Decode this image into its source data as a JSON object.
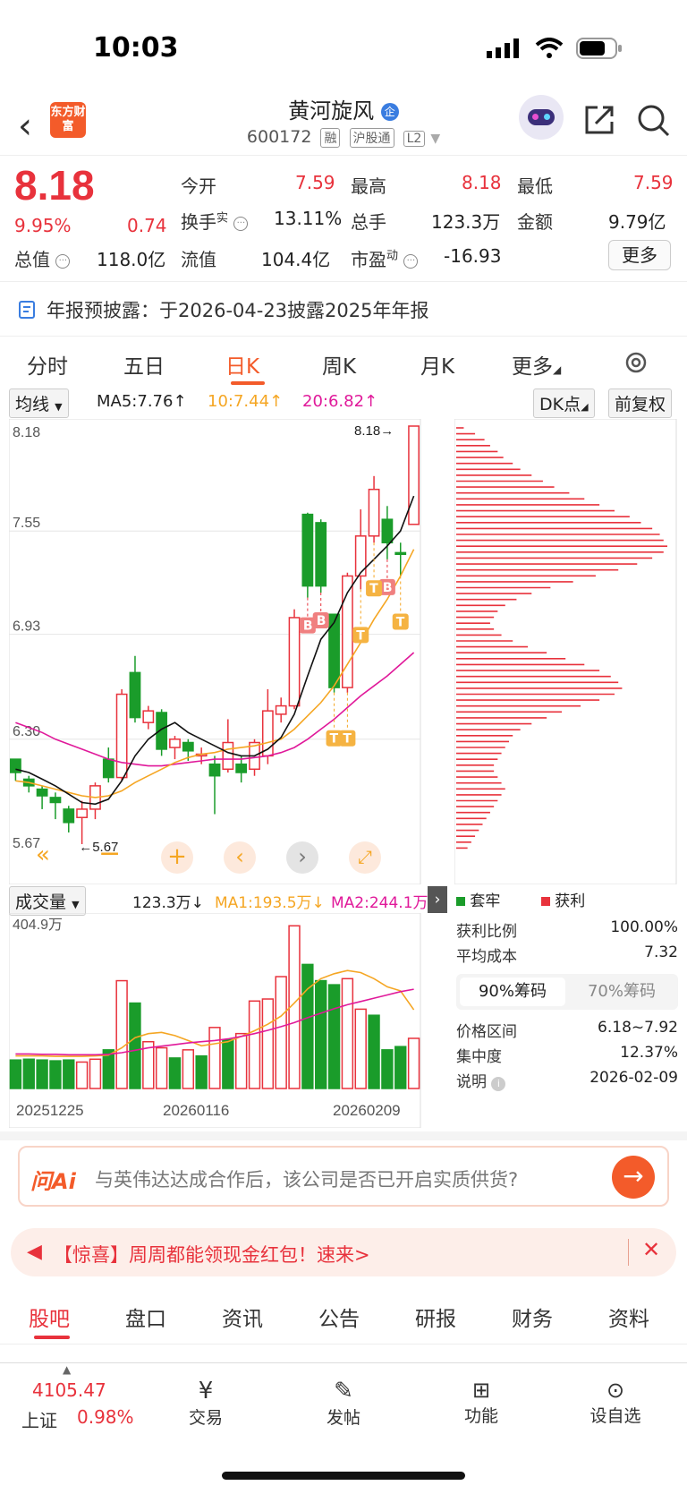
{
  "status": {
    "time": "10:03"
  },
  "header": {
    "logo_text": "东方财富",
    "title": "黄河旋风",
    "title_badge": "企",
    "code": "600172",
    "tags": [
      "融",
      "沪股通",
      "L2"
    ]
  },
  "quote": {
    "price": "8.18",
    "change_pct": "9.95%",
    "change": "0.74",
    "open_label": "今开",
    "open": "7.59",
    "high_label": "最高",
    "high": "8.18",
    "low_label": "最低",
    "low": "7.59",
    "turnover_label": "换手",
    "turnover_sup": "实",
    "turnover": "13.11%",
    "volume_label": "总手",
    "volume": "123.3万",
    "amount_label": "金额",
    "amount": "9.79亿",
    "mktcap_label": "总值",
    "mktcap": "118.0亿",
    "float_label": "流值",
    "float": "104.4亿",
    "pe_label": "市盈",
    "pe_sup": "动",
    "pe": "-16.93",
    "more_label": "更多"
  },
  "notice": {
    "text": "年报预披露：于2026-04-23披露2025年年报"
  },
  "ktabs": [
    "分时",
    "五日",
    "日K",
    "周K",
    "月K",
    "更多"
  ],
  "ma_bar": {
    "select": "均线",
    "ma5": "MA5:7.76↑",
    "ma10": "10:7.44↑",
    "ma20": "20:6.82↑",
    "dk": "DK点",
    "adjust": "前复权",
    "colors": {
      "ma5": "#111111",
      "ma10": "#f5a623",
      "ma20": "#e0199a"
    }
  },
  "chart_data": [
    {
      "type": "candlestick",
      "y_tick_labels": [
        "8.18",
        "7.55",
        "6.93",
        "6.30",
        "5.67"
      ],
      "ylim": [
        5.67,
        8.18
      ],
      "annotations": [
        "8.18→",
        "←5.67"
      ],
      "candles": [
        {
          "o": 6.18,
          "c": 6.1,
          "h": 6.18,
          "l": 6.05
        },
        {
          "o": 6.06,
          "c": 6.02,
          "h": 6.08,
          "l": 5.98
        },
        {
          "o": 6.0,
          "c": 5.96,
          "h": 6.02,
          "l": 5.88
        },
        {
          "o": 5.95,
          "c": 5.92,
          "h": 5.98,
          "l": 5.82
        },
        {
          "o": 5.88,
          "c": 5.8,
          "h": 5.9,
          "l": 5.74
        },
        {
          "o": 5.83,
          "c": 5.88,
          "h": 5.93,
          "l": 5.67
        },
        {
          "o": 5.88,
          "c": 6.02,
          "h": 6.04,
          "l": 5.82
        },
        {
          "o": 6.18,
          "c": 6.07,
          "h": 6.25,
          "l": 6.04
        },
        {
          "o": 6.07,
          "c": 6.57,
          "h": 6.6,
          "l": 6.05
        },
        {
          "o": 6.7,
          "c": 6.43,
          "h": 6.8,
          "l": 6.4
        },
        {
          "o": 6.4,
          "c": 6.47,
          "h": 6.5,
          "l": 6.36
        },
        {
          "o": 6.46,
          "c": 6.24,
          "h": 6.48,
          "l": 6.2
        },
        {
          "o": 6.25,
          "c": 6.3,
          "h": 6.32,
          "l": 6.18
        },
        {
          "o": 6.28,
          "c": 6.23,
          "h": 6.3,
          "l": 6.17
        },
        {
          "o": 6.2,
          "c": 6.21,
          "h": 6.25,
          "l": 6.15
        },
        {
          "o": 6.15,
          "c": 6.08,
          "h": 6.2,
          "l": 5.85
        },
        {
          "o": 6.12,
          "c": 6.28,
          "h": 6.42,
          "l": 6.1
        },
        {
          "o": 6.15,
          "c": 6.1,
          "h": 6.2,
          "l": 6.04
        },
        {
          "o": 6.12,
          "c": 6.28,
          "h": 6.3,
          "l": 6.08
        },
        {
          "o": 6.2,
          "c": 6.47,
          "h": 6.6,
          "l": 6.15
        },
        {
          "o": 6.45,
          "c": 6.5,
          "h": 6.55,
          "l": 6.4
        },
        {
          "o": 6.5,
          "c": 7.03,
          "h": 7.08,
          "l": 6.48
        },
        {
          "o": 7.65,
          "c": 7.22,
          "h": 7.66,
          "l": 7.15
        },
        {
          "o": 7.6,
          "c": 7.22,
          "h": 7.62,
          "l": 7.18
        },
        {
          "o": 7.05,
          "c": 6.61,
          "h": 7.05,
          "l": 6.58
        },
        {
          "o": 6.61,
          "c": 7.28,
          "h": 7.3,
          "l": 6.58
        },
        {
          "o": 7.28,
          "c": 7.52,
          "h": 7.68,
          "l": 7.2
        },
        {
          "o": 7.52,
          "c": 7.8,
          "h": 7.88,
          "l": 7.48
        },
        {
          "o": 7.62,
          "c": 7.48,
          "h": 7.7,
          "l": 7.38
        },
        {
          "o": 7.42,
          "c": 7.41,
          "h": 7.48,
          "l": 7.28
        },
        {
          "o": 7.59,
          "c": 8.18,
          "h": 8.18,
          "l": 7.59
        }
      ],
      "ma5": [
        6.12,
        6.1,
        6.06,
        6.02,
        5.97,
        5.92,
        5.91,
        5.94,
        6.05,
        6.2,
        6.3,
        6.36,
        6.4,
        6.34,
        6.3,
        6.26,
        6.22,
        6.2,
        6.2,
        6.24,
        6.31,
        6.45,
        6.68,
        6.9,
        7.0,
        7.18,
        7.3,
        7.38,
        7.46,
        7.55,
        7.76
      ],
      "ma10": [
        6.05,
        6.04,
        6.02,
        6.0,
        5.98,
        5.96,
        5.95,
        5.96,
        5.99,
        6.04,
        6.08,
        6.12,
        6.16,
        6.19,
        6.21,
        6.22,
        6.24,
        6.25,
        6.26,
        6.28,
        6.3,
        6.36,
        6.44,
        6.52,
        6.62,
        6.75,
        6.88,
        7.02,
        7.14,
        7.28,
        7.44
      ],
      "ma20": [
        6.4,
        6.37,
        6.34,
        6.3,
        6.27,
        6.24,
        6.21,
        6.18,
        6.16,
        6.15,
        6.14,
        6.14,
        6.15,
        6.16,
        6.17,
        6.18,
        6.18,
        6.18,
        6.19,
        6.2,
        6.22,
        6.25,
        6.3,
        6.36,
        6.42,
        6.49,
        6.56,
        6.62,
        6.68,
        6.75,
        6.82
      ],
      "marks": [
        "B",
        "B",
        "B",
        "T",
        "T",
        "T",
        "T",
        "T"
      ]
    },
    {
      "type": "bar",
      "title": "成交量",
      "ylim": [
        0,
        404.9
      ],
      "y_tick_label": "404.9万",
      "x_tick_labels": [
        "20251225",
        "20260116",
        "20260209"
      ],
      "values": [
        70,
        72,
        70,
        68,
        70,
        65,
        72,
        95,
        265,
        210,
        115,
        100,
        75,
        95,
        80,
        150,
        120,
        135,
        215,
        220,
        275,
        400,
        305,
        265,
        255,
        270,
        195,
        180,
        95,
        103,
        123.3
      ],
      "up": [
        false,
        false,
        false,
        false,
        false,
        true,
        true,
        false,
        true,
        false,
        true,
        true,
        false,
        true,
        false,
        true,
        false,
        true,
        true,
        true,
        true,
        true,
        false,
        false,
        false,
        true,
        true,
        false,
        false,
        false,
        true
      ],
      "ma1": [
        80,
        80,
        80,
        79,
        79,
        79,
        80,
        82,
        100,
        125,
        135,
        138,
        130,
        118,
        105,
        110,
        115,
        128,
        142,
        158,
        178,
        210,
        245,
        270,
        282,
        290,
        285,
        270,
        250,
        240,
        193.5
      ],
      "ma2": [
        85,
        85,
        84,
        84,
        83,
        83,
        83,
        84,
        88,
        94,
        100,
        104,
        108,
        112,
        115,
        118,
        122,
        128,
        135,
        143,
        152,
        162,
        174,
        185,
        196,
        206,
        214,
        222,
        230,
        238,
        244.1
      ]
    },
    {
      "type": "bar",
      "title": "筹码分布",
      "legend": [
        "套牢",
        "获利"
      ],
      "values": [
        4,
        10,
        15,
        18,
        22,
        25,
        30,
        34,
        40,
        46,
        52,
        60,
        68,
        76,
        84,
        92,
        98,
        104,
        108,
        110,
        112,
        110,
        104,
        96,
        86,
        74,
        62,
        50,
        40,
        32,
        26,
        22,
        20,
        18,
        20,
        24,
        30,
        38,
        48,
        58,
        68,
        76,
        82,
        86,
        88,
        84,
        76,
        66,
        56,
        48,
        40,
        34,
        30,
        28,
        26,
        24,
        22,
        20,
        20,
        22,
        24,
        26,
        24,
        22,
        20,
        18,
        16,
        14,
        12,
        10,
        8,
        6
      ]
    }
  ],
  "volume_bar": {
    "select": "成交量",
    "vol": "123.3万↓",
    "ma1": "MA1:193.5万↓",
    "ma2": "MA2:244.1万",
    "colors": {
      "ma1": "#f5a623",
      "ma2": "#e0199a"
    }
  },
  "chips": {
    "legend_trap": "套牢",
    "legend_profit": "获利",
    "rows_top": [
      {
        "label": "获利比例",
        "value": "100.00%"
      },
      {
        "label": "平均成本",
        "value": "7.32"
      }
    ],
    "tab_90": "90%筹码",
    "tab_70": "70%筹码",
    "rows_bottom": [
      {
        "label": "价格区间",
        "value": "6.18~7.92"
      },
      {
        "label": "集中度",
        "value": "12.37%"
      },
      {
        "label": "说明",
        "value": "2026-02-09"
      }
    ]
  },
  "ai": {
    "brand": "问Ai",
    "placeholder": "与英伟达达成合作后，该公司是否已开启实质供货?"
  },
  "promo": {
    "text": "【惊喜】周周都能领现金红包！速来>"
  },
  "bottom_tabs": [
    "股吧",
    "盘口",
    "资讯",
    "公告",
    "研报",
    "财务",
    "资料"
  ],
  "footer": {
    "index_value": "4105.47",
    "index_name": "上证",
    "index_pct": "0.98%",
    "items": [
      "交易",
      "发帖",
      "功能",
      "设自选"
    ]
  }
}
